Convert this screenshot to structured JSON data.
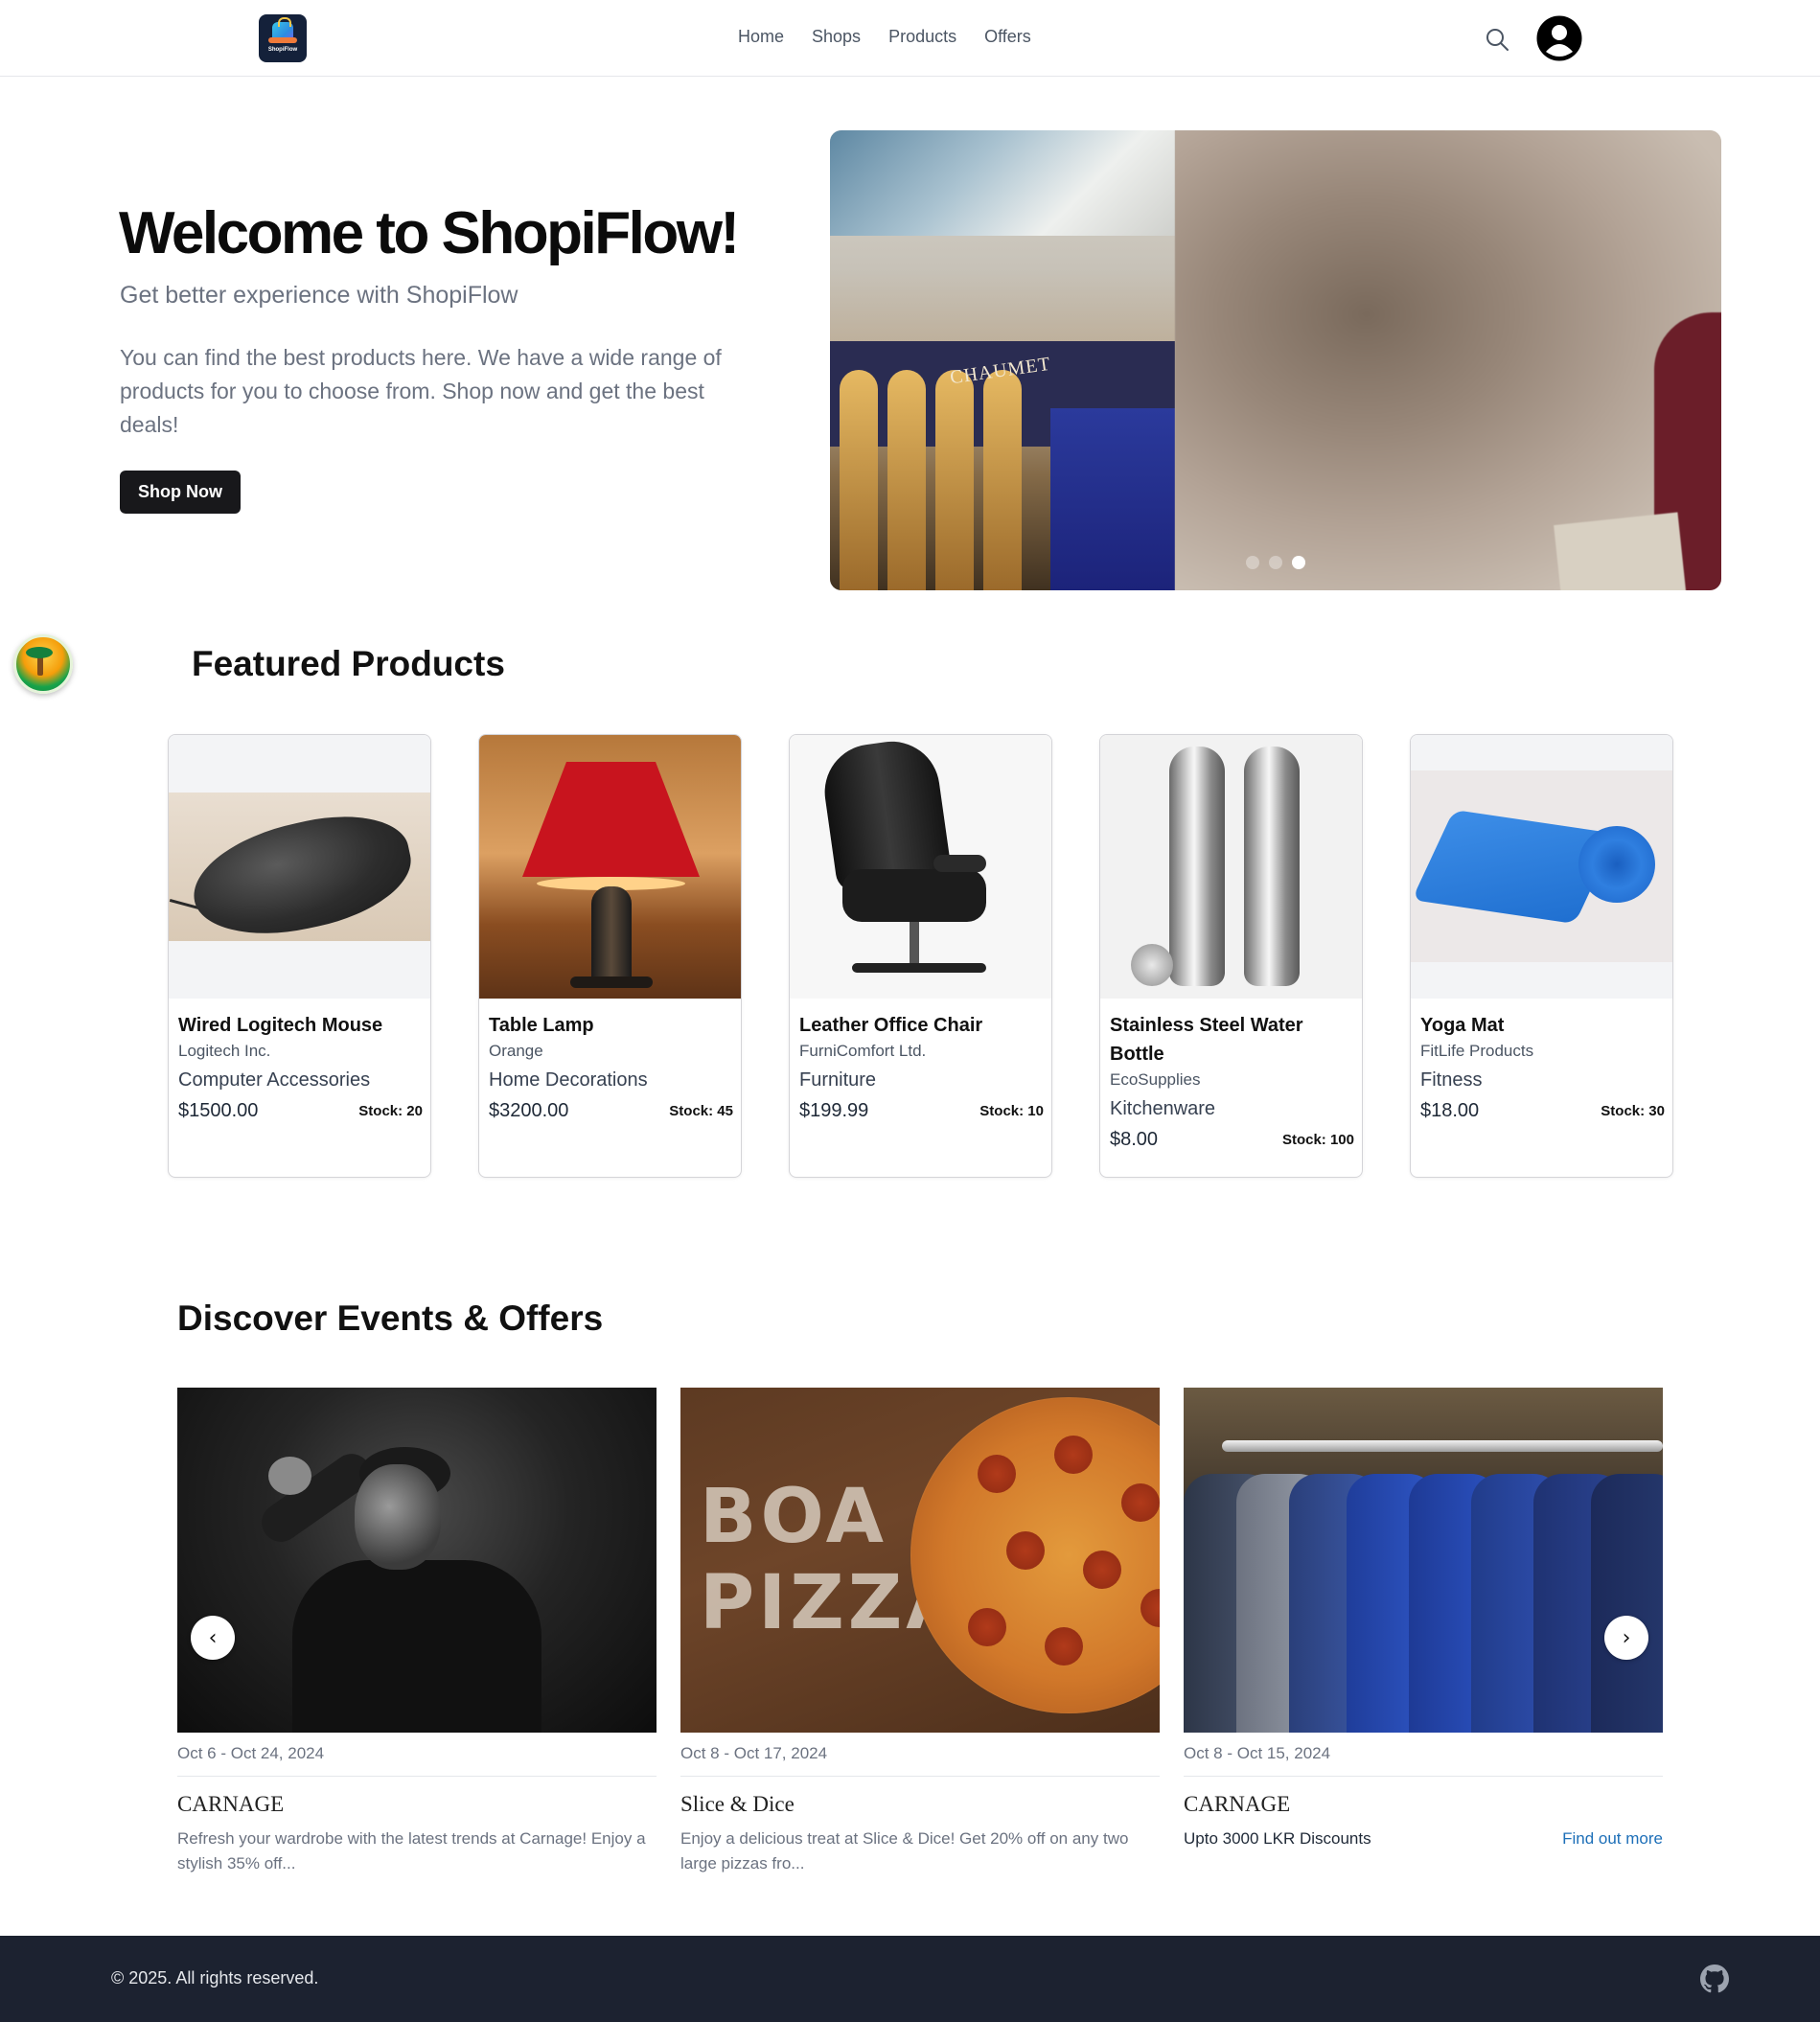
{
  "header": {
    "logo_text": "ShopiFlow",
    "nav": [
      {
        "label": "Home"
      },
      {
        "label": "Shops"
      },
      {
        "label": "Products"
      },
      {
        "label": "Offers"
      }
    ],
    "icons": [
      "search-icon",
      "user-avatar-icon"
    ]
  },
  "hero": {
    "title": "Welcome to ShopiFlow!",
    "subtitle": "Get better experience with ShopiFlow",
    "description": "You can find the best products here. We have a wide range of products for you to choose from. Shop now and get the best deals!",
    "cta_label": "Shop Now",
    "slider": {
      "store_sign": "CHAUMET",
      "slide_count": 3,
      "active_slide": 3
    }
  },
  "featured": {
    "title": "Featured Products",
    "products": [
      {
        "name": "Wired Logitech Mouse",
        "brand": "Logitech Inc.",
        "category": "Computer Accessories",
        "price": "$1500.00",
        "stock": "Stock: 20"
      },
      {
        "name": "Table Lamp",
        "brand": "Orange",
        "category": "Home Decorations",
        "price": "$3200.00",
        "stock": "Stock: 45"
      },
      {
        "name": "Leather Office Chair",
        "brand": "FurniComfort Ltd.",
        "category": "Furniture",
        "price": "$199.99",
        "stock": "Stock: 10"
      },
      {
        "name": "Stainless Steel Water Bottle",
        "brand": "EcoSupplies",
        "category": "Kitchenware",
        "price": "$8.00",
        "stock": "Stock: 100"
      },
      {
        "name": "Yoga Mat",
        "brand": "FitLife Products",
        "category": "Fitness",
        "price": "$18.00",
        "stock": "Stock: 30"
      }
    ]
  },
  "events": {
    "title": "Discover Events & Offers",
    "items": [
      {
        "date": "Oct 6  -  Oct 24, 2024",
        "title": "CARNAGE",
        "description": "Refresh your wardrobe with the latest trends at Carnage! Enjoy a stylish 35% off..."
      },
      {
        "date": "Oct 8  -  Oct 17, 2024",
        "title": "Slice & Dice",
        "description": "Enjoy a delicious treat at Slice & Dice! Get 20% off on any two large pizzas fro...",
        "image_text": "BOA PIZZA"
      },
      {
        "date": "Oct 8  -  Oct 15, 2024",
        "title": "CARNAGE",
        "description": "Upto 3000 LKR Discounts",
        "link_label": "Find out more"
      }
    ],
    "prev_icon": "‹",
    "next_icon": "›"
  },
  "footer": {
    "copyright": "© 2025. All rights reserved.",
    "icon": "github-icon"
  },
  "colors": {
    "primary_button": "#18181b",
    "footer_bg": "#1c2230",
    "link": "#1d6fb8",
    "muted_text": "#6b7280"
  }
}
